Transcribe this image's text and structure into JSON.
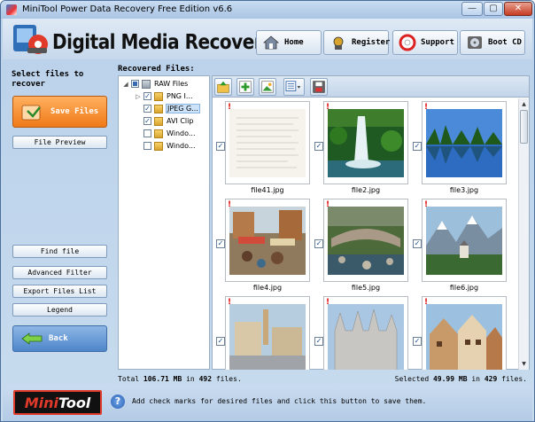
{
  "window": {
    "title": "MiniTool Power Data Recovery Free Edition v6.6",
    "min": "—",
    "max": "▢",
    "close": "✕"
  },
  "header": {
    "brand": "Digital Media Recovery",
    "buttons": [
      {
        "label": "Home",
        "icon": "home-icon"
      },
      {
        "label": "Register",
        "icon": "register-icon"
      },
      {
        "label": "Support",
        "icon": "support-icon"
      },
      {
        "label": "Boot CD",
        "icon": "bootcd-icon"
      }
    ]
  },
  "left": {
    "title": "Select files to recover",
    "save": "Save Files",
    "preview": "File Preview",
    "find": "Find file",
    "advanced": "Advanced Filter",
    "export": "Export Files List",
    "legend": "Legend",
    "back": "Back"
  },
  "main": {
    "title": "Recovered Files:",
    "tree": [
      {
        "label": "RAW Files",
        "expander": "◢",
        "check": "",
        "state": "partial"
      },
      {
        "label": "PNG I...",
        "expander": "▷",
        "check": "✓",
        "state": "checked"
      },
      {
        "label": "JPEG G...",
        "expander": "",
        "check": "✓",
        "state": "checked",
        "selected": true
      },
      {
        "label": "AVI Clip",
        "expander": "",
        "check": "✓",
        "state": "checked"
      },
      {
        "label": "Windo...",
        "expander": "",
        "check": "",
        "state": "unchecked"
      },
      {
        "label": "Windo...",
        "expander": "",
        "check": "",
        "state": "unchecked"
      }
    ],
    "toolbar": [
      "up-folder-icon",
      "add-icon",
      "image-view-icon",
      "view-mode-icon",
      "save-icon"
    ],
    "files": [
      {
        "name": "file41.jpg",
        "mark": "!",
        "check": "✓"
      },
      {
        "name": "file2.jpg",
        "mark": "!",
        "check": "✓"
      },
      {
        "name": "file3.jpg",
        "mark": "!",
        "check": "✓"
      },
      {
        "name": "file4.jpg",
        "mark": "!",
        "check": "✓"
      },
      {
        "name": "file5.jpg",
        "mark": "!",
        "check": "✓"
      },
      {
        "name": "file6.jpg",
        "mark": "!",
        "check": "✓"
      },
      {
        "name": "",
        "mark": "!",
        "check": "✓"
      },
      {
        "name": "",
        "mark": "!",
        "check": "✓"
      },
      {
        "name": "",
        "mark": "!",
        "check": "✓"
      }
    ],
    "status": {
      "total_prefix": "Total",
      "total_size": "106.71 MB",
      "total_in": "in",
      "total_count": "492",
      "total_suffix": "files.",
      "sel_prefix": "Selected",
      "sel_size": "49.99 MB",
      "sel_in": "in",
      "sel_count": "429",
      "sel_suffix": "files."
    }
  },
  "footer": {
    "logo_a": "Mini",
    "logo_b": "Tool",
    "help": "?",
    "hint": "Add check marks for desired files and click this button to save them."
  }
}
